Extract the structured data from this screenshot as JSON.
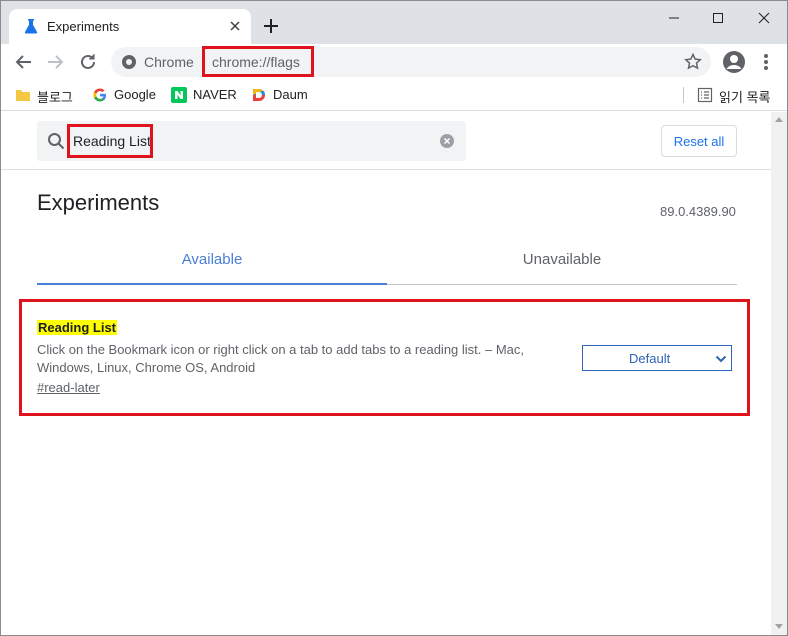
{
  "browser": {
    "tab_title": "Experiments",
    "omnibox_label": "Chrome",
    "url": "chrome://flags"
  },
  "bookmarks": {
    "items": [
      {
        "label": "블로그",
        "icon": "folder-icon"
      },
      {
        "label": "Google",
        "icon": "google-icon"
      },
      {
        "label": "NAVER",
        "icon": "naver-icon"
      },
      {
        "label": "Daum",
        "icon": "daum-icon"
      }
    ],
    "reading_list": "읽기 목록"
  },
  "page": {
    "search_value": "Reading List",
    "reset_label": "Reset all",
    "title": "Experiments",
    "version": "89.0.4389.90",
    "tabs": [
      "Available",
      "Unavailable"
    ],
    "active_tab": "Available"
  },
  "flag": {
    "name": "Reading List",
    "description": "Click on the Bookmark icon or right click on a tab to add tabs to a reading list. – Mac, Windows, Linux, Chrome OS, Android",
    "link": "#read-later",
    "selected_option": "Default"
  },
  "colors": {
    "accent": "#1a73e8",
    "highlight_box": "#e0121b",
    "search_highlight": "#ffff00"
  }
}
